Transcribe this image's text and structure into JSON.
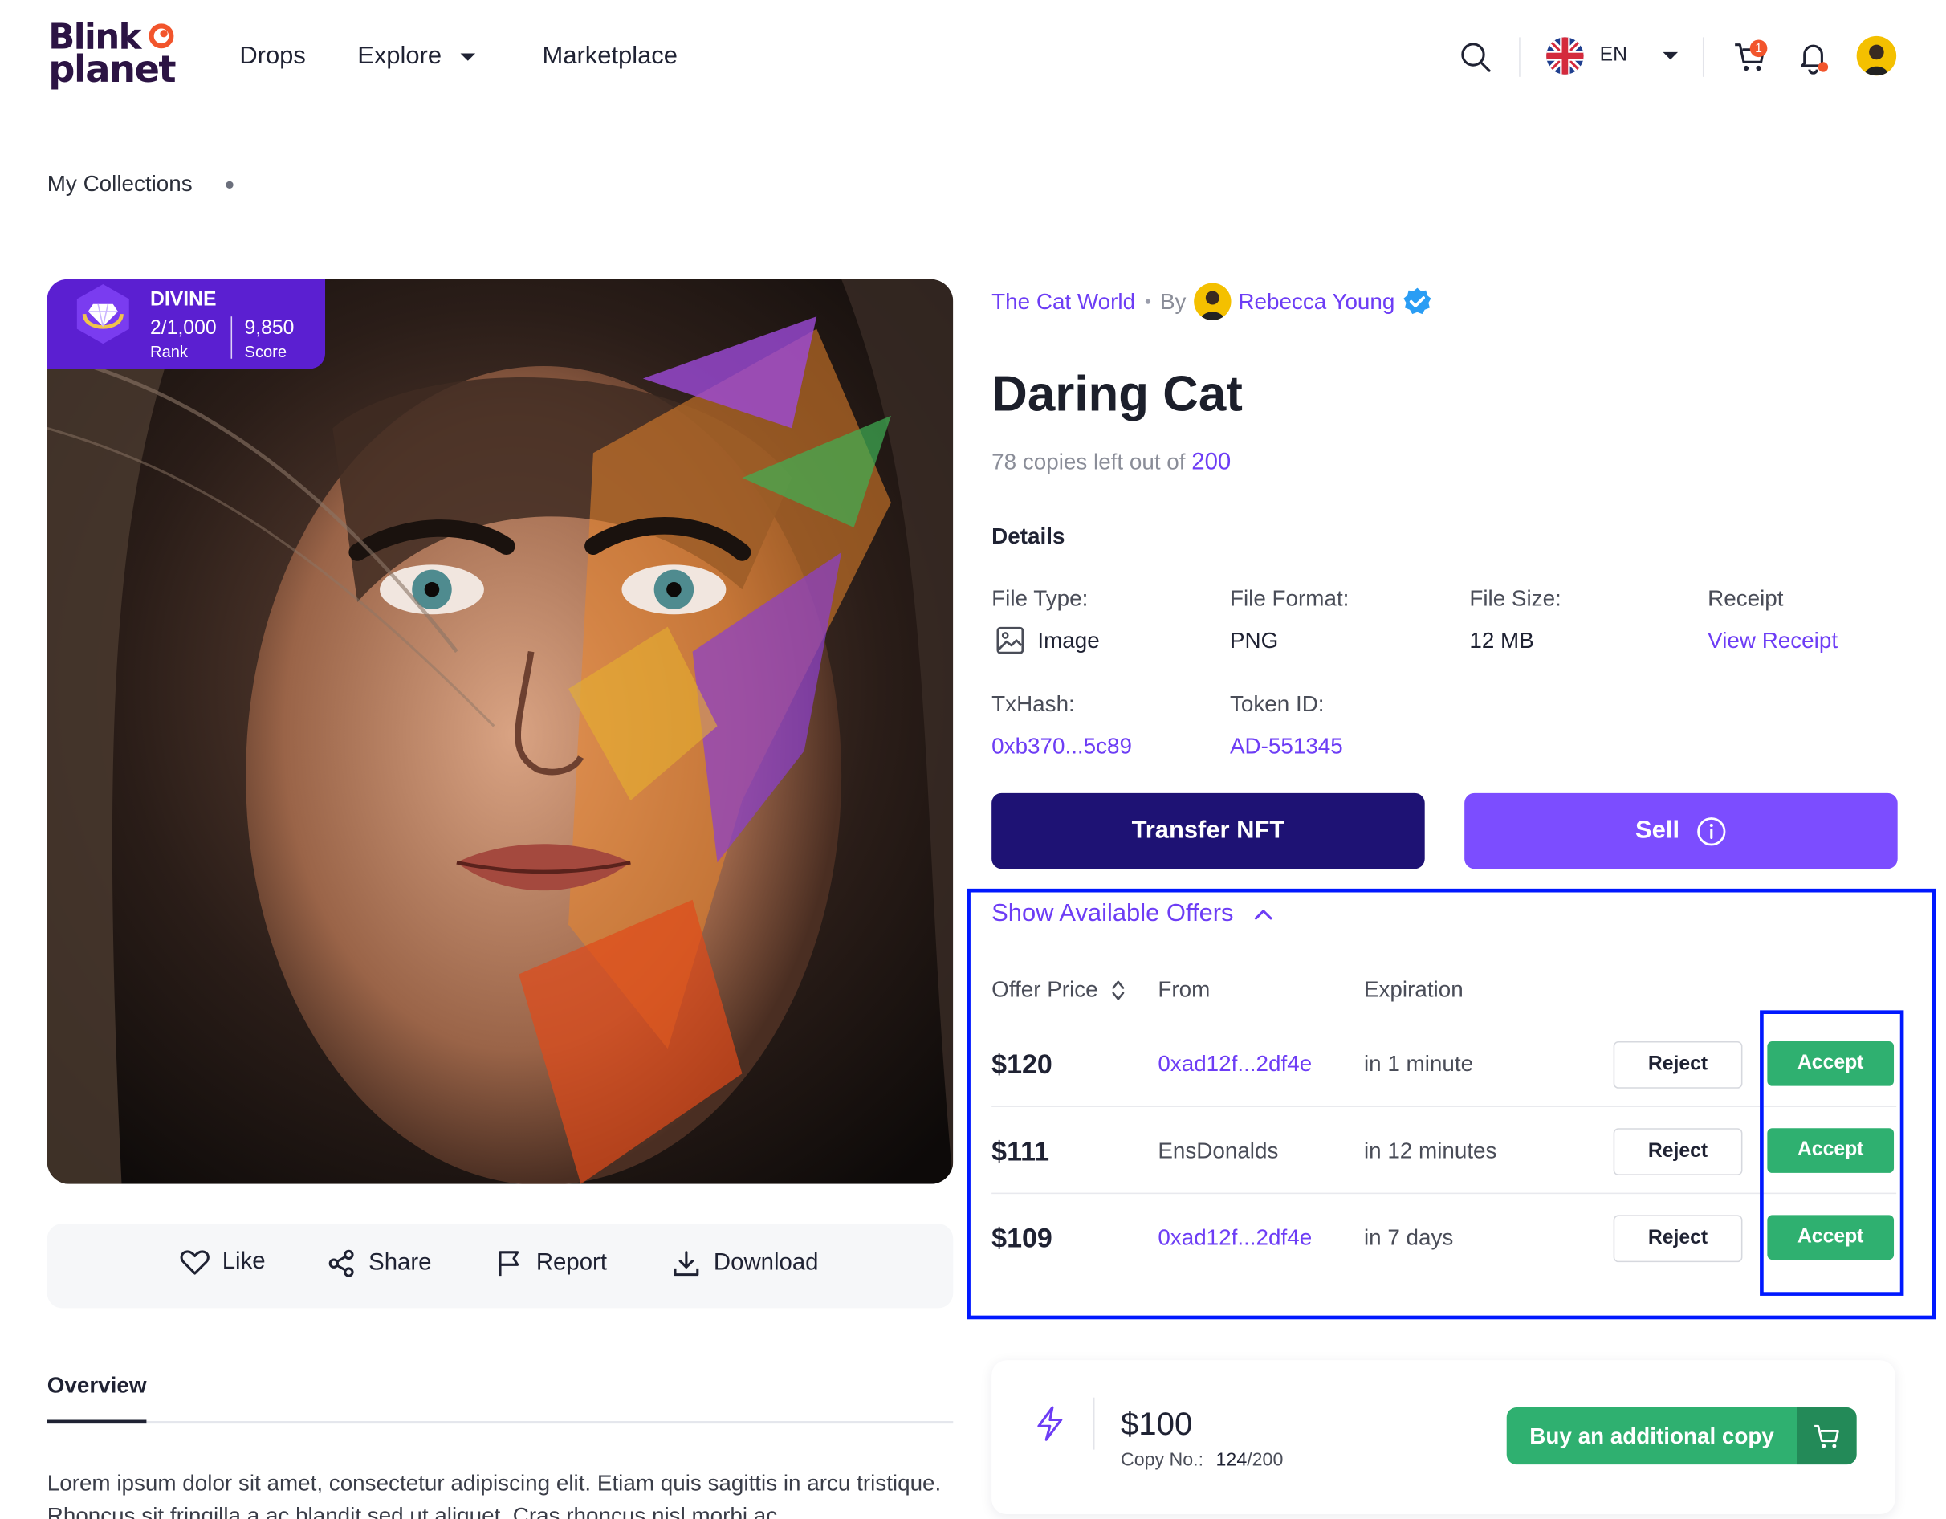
{
  "brand": {
    "line1": "Blink",
    "line2": "planet"
  },
  "nav": {
    "drops": "Drops",
    "explore": "Explore",
    "marketplace": "Marketplace"
  },
  "header": {
    "language": "EN",
    "cart_count": "1"
  },
  "breadcrumb": {
    "label": "My Collections"
  },
  "rank_card": {
    "tier": "DIVINE",
    "rank_value": "2/1,000",
    "rank_label": "Rank",
    "score_value": "9,850",
    "score_label": "Score"
  },
  "actions": {
    "like": "Like",
    "share": "Share",
    "report": "Report",
    "download": "Download"
  },
  "overview": {
    "tab": "Overview",
    "text": "Lorem ipsum dolor sit amet, consectetur adipiscing elit. Etiam quis sagittis in arcu tristique. Rhoncus sit fringilla a ac blandit sed ut aliquet. Cras rhoncus nisl morbi ac"
  },
  "item": {
    "collection": "The Cat World",
    "by": "By",
    "creator": "Rebecca Young",
    "title": "Daring Cat",
    "copies_text": "78 copies left out of",
    "copies_total": "200"
  },
  "details": {
    "heading": "Details",
    "file_type_label": "File Type:",
    "file_type_value": "Image",
    "file_format_label": "File Format:",
    "file_format_value": "PNG",
    "file_size_label": "File Size:",
    "file_size_value": "12 MB",
    "receipt_label": "Receipt",
    "receipt_link": "View Receipt",
    "txhash_label": "TxHash:",
    "txhash_value": "0xb370...5c89",
    "token_label": "Token ID:",
    "token_value": "AD-551345"
  },
  "buttons": {
    "transfer": "Transfer NFT",
    "sell": "Sell"
  },
  "offers": {
    "toggle": "Show Available Offers",
    "columns": {
      "price": "Offer Price",
      "from": "From",
      "expiration": "Expiration"
    },
    "reject_label": "Reject",
    "accept_label": "Accept",
    "rows": [
      {
        "price": "$120",
        "from": "0xad12f...2df4e",
        "expiration": "in 1 minute"
      },
      {
        "price": "$111",
        "from": "EnsDonalds",
        "expiration": "in 12 minutes"
      },
      {
        "price": "$109",
        "from": "0xad12f...2df4e",
        "expiration": "in 7 days"
      }
    ]
  },
  "buy": {
    "price": "$100",
    "copy_label": "Copy No.:",
    "copy_number": "124",
    "copy_total": "/200",
    "button": "Buy an additional copy"
  },
  "colors": {
    "accent": "#6d3df5",
    "primary_dark": "#1e1274",
    "sell": "#7c4dff",
    "success": "#2fb070",
    "highlight": "#0018ff"
  }
}
